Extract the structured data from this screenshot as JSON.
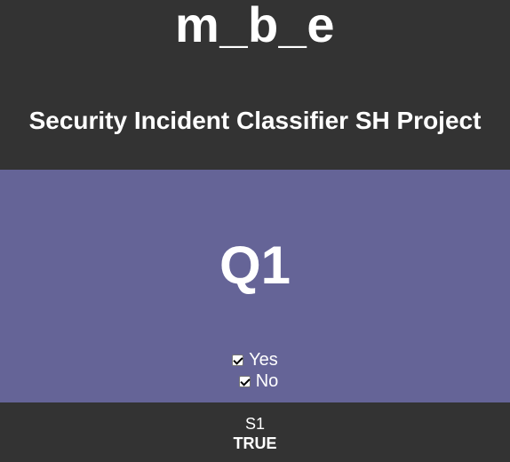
{
  "header": {
    "brand": "m_b_e",
    "subtitle": "Security Incident Classifier SH Project"
  },
  "question": {
    "title": "Q1",
    "options": [
      {
        "label": "Yes",
        "checked": true
      },
      {
        "label": "No",
        "checked": true
      }
    ]
  },
  "footer": {
    "label": "S1",
    "value": "TRUE"
  },
  "colors": {
    "background": "#333333",
    "panel": "#656497",
    "text": "#ffffff"
  }
}
